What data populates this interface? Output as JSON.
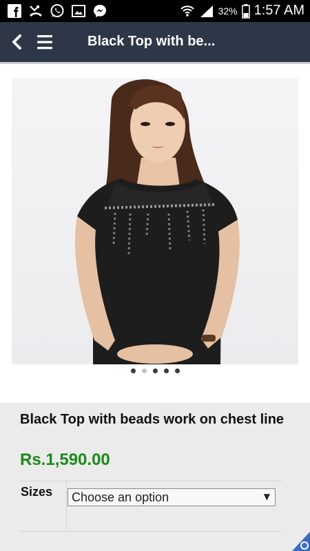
{
  "status_bar": {
    "icons": [
      "facebook-icon",
      "missed-call-icon",
      "whatsapp-icon",
      "gallery-icon",
      "messenger-icon",
      "wifi-icon",
      "signal-icon",
      "battery-icon"
    ],
    "battery": "32%",
    "time": "1:57 AM"
  },
  "app_bar": {
    "title": "Black Top with be...",
    "background": "#2e3747"
  },
  "product": {
    "image_icon": "product-photo",
    "image_count": 5,
    "active_image": 1,
    "name": "Black Top with beads work on chest line",
    "price": "Rs.1,590.00",
    "price_color": "#1a8a1a"
  },
  "variations": {
    "sizes_label": "Sizes",
    "sizes_selected": "Choose an option"
  }
}
